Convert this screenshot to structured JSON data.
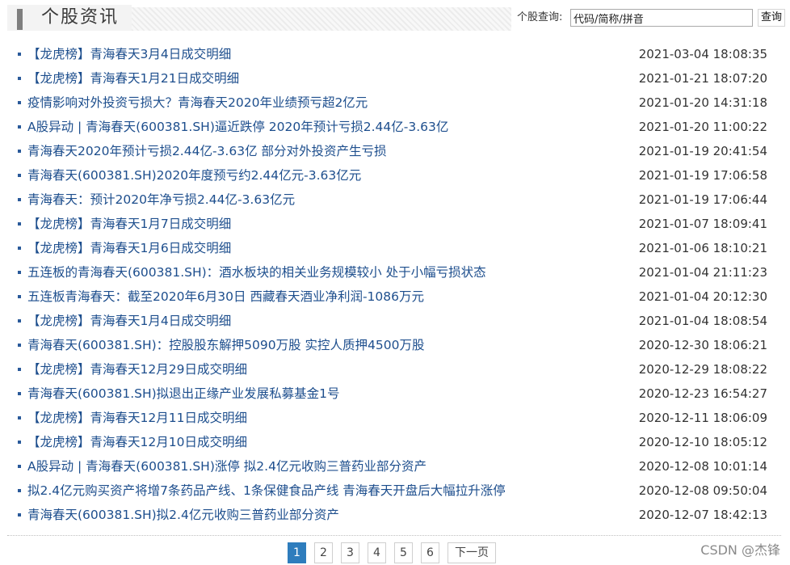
{
  "header": {
    "title": "个股资讯",
    "search_label": "个股查询:",
    "search_value": "代码/简称/拼音",
    "search_button": "查询"
  },
  "news": [
    {
      "title": "【龙虎榜】青海春天3月4日成交明细",
      "date": "2021-03-04 18:08:35"
    },
    {
      "title": "【龙虎榜】青海春天1月21日成交明细",
      "date": "2021-01-21 18:07:20"
    },
    {
      "title": "疫情影响对外投资亏损大？青海春天2020年业绩预亏超2亿元",
      "date": "2021-01-20 14:31:18"
    },
    {
      "title": "A股异动 | 青海春天(600381.SH)逼近跌停 2020年预计亏损2.44亿-3.63亿",
      "date": "2021-01-20 11:00:22"
    },
    {
      "title": "青海春天2020年预计亏损2.44亿-3.63亿 部分对外投资产生亏损",
      "date": "2021-01-19 20:41:54"
    },
    {
      "title": "青海春天(600381.SH)2020年度预亏约2.44亿元-3.63亿元",
      "date": "2021-01-19 17:06:58"
    },
    {
      "title": "青海春天：预计2020年净亏损2.44亿-3.63亿元",
      "date": "2021-01-19 17:06:44"
    },
    {
      "title": "【龙虎榜】青海春天1月7日成交明细",
      "date": "2021-01-07 18:09:41"
    },
    {
      "title": "【龙虎榜】青海春天1月6日成交明细",
      "date": "2021-01-06 18:10:21"
    },
    {
      "title": "五连板的青海春天(600381.SH)：酒水板块的相关业务规模较小 处于小幅亏损状态",
      "date": "2021-01-04 21:11:23"
    },
    {
      "title": "五连板青海春天：截至2020年6月30日 西藏春天酒业净利润-1086万元",
      "date": "2021-01-04 20:12:30"
    },
    {
      "title": "【龙虎榜】青海春天1月4日成交明细",
      "date": "2021-01-04 18:08:54"
    },
    {
      "title": "青海春天(600381.SH)：控股股东解押5090万股 实控人质押4500万股",
      "date": "2020-12-30 18:06:21"
    },
    {
      "title": "【龙虎榜】青海春天12月29日成交明细",
      "date": "2020-12-29 18:08:22"
    },
    {
      "title": "青海春天(600381.SH)拟退出正缘产业发展私募基金1号",
      "date": "2020-12-23 16:54:27"
    },
    {
      "title": "【龙虎榜】青海春天12月11日成交明细",
      "date": "2020-12-11 18:06:09"
    },
    {
      "title": "【龙虎榜】青海春天12月10日成交明细",
      "date": "2020-12-10 18:05:12"
    },
    {
      "title": "A股异动 | 青海春天(600381.SH)涨停 拟2.4亿元收购三普药业部分资产",
      "date": "2020-12-08 10:01:14"
    },
    {
      "title": "拟2.4亿元购买资产将增7条药品产线、1条保健食品产线 青海春天开盘后大幅拉升涨停",
      "date": "2020-12-08 09:50:04"
    },
    {
      "title": "青海春天(600381.SH)拟2.4亿元收购三普药业部分资产",
      "date": "2020-12-07 18:42:13"
    }
  ],
  "pagination": {
    "pages": [
      "1",
      "2",
      "3",
      "4",
      "5",
      "6"
    ],
    "current": "1",
    "next_label": "下一页"
  },
  "watermark": "CSDN @杰锋",
  "colors": {
    "link": "#1d4e8d",
    "active_page": "#2e7dbd"
  }
}
